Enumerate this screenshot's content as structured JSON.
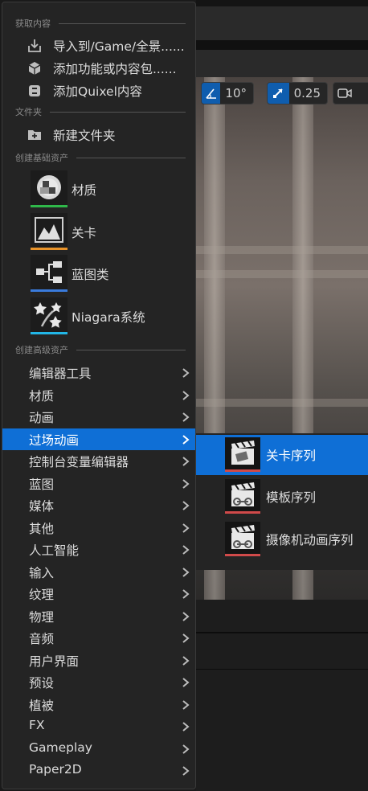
{
  "menu": {
    "sections": {
      "get_content": "获取内容",
      "folder": "文件夹",
      "basic_assets": "创建基础资产",
      "advanced_assets": "创建高级资产"
    },
    "get_content_items": [
      {
        "label": "导入到/Game/全景......",
        "icon": "import-icon"
      },
      {
        "label": "添加功能或内容包......",
        "icon": "content-pack-icon"
      },
      {
        "label": "添加Quixel内容",
        "icon": "quixel-icon"
      }
    ],
    "folder_items": [
      {
        "label": "新建文件夹",
        "icon": "new-folder-icon"
      }
    ],
    "basic_items": [
      {
        "label": "材质",
        "icon": "material-icon",
        "color": "#2fb84a"
      },
      {
        "label": "关卡",
        "icon": "level-icon",
        "color": "#e8932a"
      },
      {
        "label": "蓝图类",
        "icon": "blueprint-icon",
        "color": "#3a7bdc"
      },
      {
        "label": "Niagara系统",
        "icon": "niagara-icon",
        "color": "#22b6e6"
      }
    ],
    "advanced_items": [
      "编辑器工具",
      "材质",
      "动画",
      "过场动画",
      "控制台变量编辑器",
      "蓝图",
      "媒体",
      "其他",
      "人工智能",
      "输入",
      "纹理",
      "物理",
      "音频",
      "用户界面",
      "预设",
      "植被",
      "FX",
      "Gameplay",
      "Paper2D"
    ],
    "active_item": "过场动画"
  },
  "submenu": {
    "items": [
      {
        "label": "关卡序列",
        "icon": "level-sequence-icon",
        "active": true
      },
      {
        "label": "模板序列",
        "icon": "template-sequence-icon",
        "active": false
      },
      {
        "label": "摄像机动画序列",
        "icon": "camera-anim-sequence-icon",
        "active": false
      }
    ]
  },
  "viewport_toolbar": {
    "rotation_snap": "10°",
    "scale_snap": "0.25"
  },
  "colors": {
    "accent": "#0f6fd6",
    "menu_bg": "#242424",
    "sequence_stripe": "#d04a4a"
  }
}
